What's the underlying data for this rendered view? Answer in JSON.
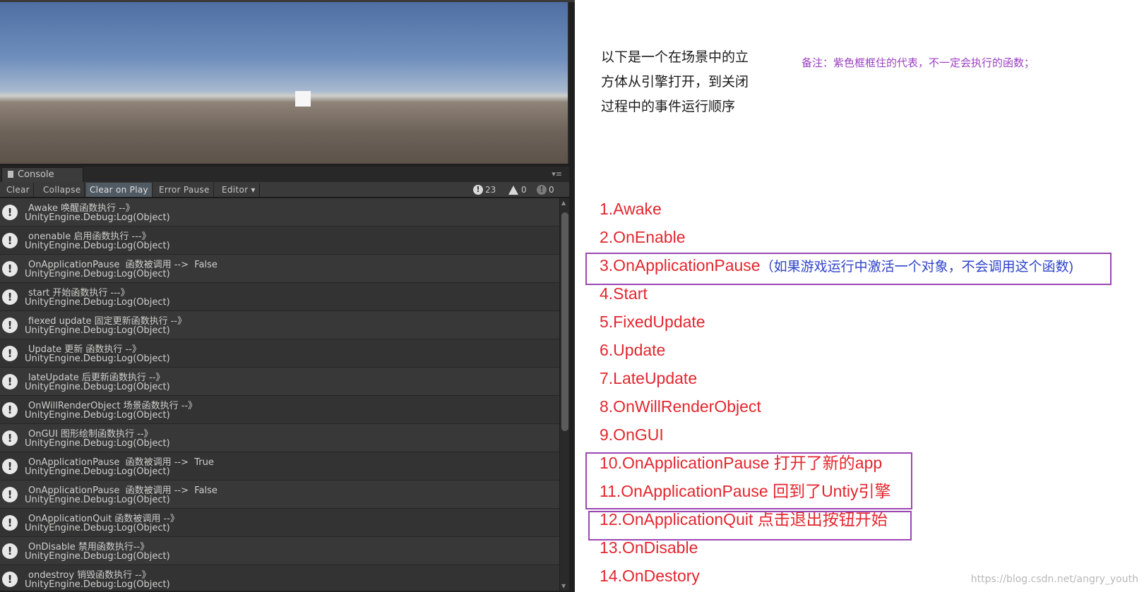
{
  "console": {
    "tab_label": "Console",
    "toolbar": {
      "clear": "Clear",
      "collapse": "Collapse",
      "clear_on_play": "Clear on Play",
      "error_pause": "Error Pause",
      "editor": "Editor ▾"
    },
    "counts": {
      "info": "23",
      "warning": "0",
      "error": "0"
    },
    "logs": [
      {
        "line1": "Awake 唤醒函数执行 --》",
        "line2": "UnityEngine.Debug:Log(Object)"
      },
      {
        "line1": "onenable 启用函数执行 ---》",
        "line2": "UnityEngine.Debug:Log(Object)"
      },
      {
        "line1": "OnApplicationPause  函数被调用 -->  False",
        "line2": "UnityEngine.Debug:Log(Object)"
      },
      {
        "line1": "start 开始函数执行 ---》",
        "line2": "UnityEngine.Debug:Log(Object)"
      },
      {
        "line1": "fiexed update 固定更新函数执行 --》",
        "line2": "UnityEngine.Debug:Log(Object)"
      },
      {
        "line1": "Update 更新 函数执行 --》",
        "line2": "UnityEngine.Debug:Log(Object)"
      },
      {
        "line1": "lateUpdate 后更新函数执行 --》",
        "line2": "UnityEngine.Debug:Log(Object)"
      },
      {
        "line1": "OnWillRenderObject 场景函数执行 --》",
        "line2": "UnityEngine.Debug:Log(Object)"
      },
      {
        "line1": "OnGUI 图形绘制函数执行 --》",
        "line2": "UnityEngine.Debug:Log(Object)"
      },
      {
        "line1": "OnApplicationPause  函数被调用 -->  True",
        "line2": "UnityEngine.Debug:Log(Object)"
      },
      {
        "line1": "OnApplicationPause  函数被调用 -->  False",
        "line2": "UnityEngine.Debug:Log(Object)"
      },
      {
        "line1": "OnApplicationQuit 函数被调用 --》",
        "line2": "UnityEngine.Debug:Log(Object)"
      },
      {
        "line1": "OnDisable 禁用函数执行--》",
        "line2": "UnityEngine.Debug:Log(Object)"
      },
      {
        "line1": "ondestroy 销毁函数执行 --》",
        "line2": "UnityEngine.Debug:Log(Object)"
      }
    ]
  },
  "notes": {
    "intro": "以下是一个在场景中的立方体从引擎打开，到关闭过程中的事件运行顺序",
    "remark": "备注：紫色框框住的代表，不一定会执行的函数；",
    "sequence": [
      {
        "text": "1.Awake",
        "note": ""
      },
      {
        "text": "2.OnEnable",
        "note": ""
      },
      {
        "text": "3.OnApplicationPause",
        "note": "（如果游戏运行中激活一个对象，不会调用这个函数)"
      },
      {
        "text": "4.Start",
        "note": ""
      },
      {
        "text": "5.FixedUpdate",
        "note": ""
      },
      {
        "text": "6.Update",
        "note": ""
      },
      {
        "text": "7.LateUpdate",
        "note": ""
      },
      {
        "text": "8.OnWillRenderObject",
        "note": ""
      },
      {
        "text": "9.OnGUI",
        "note": ""
      },
      {
        "text": "10.OnApplicationPause 打开了新的app",
        "note": ""
      },
      {
        "text": "11.OnApplicationPause 回到了Untiy引擎",
        "note": ""
      },
      {
        "text": "12.OnApplicationQuit 点击退出按钮开始",
        "note": ""
      },
      {
        "text": "13.OnDisable",
        "note": ""
      },
      {
        "text": "14.OnDestory",
        "note": ""
      }
    ],
    "watermark": "https://blog.csdn.net/angry_youth"
  },
  "colors": {
    "sequence_red": "#e3262e",
    "note_blue": "#2f44c9",
    "box_purple": "#9b47b3",
    "remark_purple": "#9b3fc2"
  }
}
